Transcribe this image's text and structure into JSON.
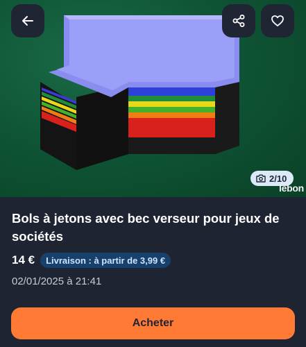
{
  "gallery": {
    "counter": "2/10",
    "watermark": "lebon"
  },
  "listing": {
    "title": "Bols à jetons avec bec verseur pour jeux de sociétés",
    "price": "14 €",
    "delivery_badge": "Livraison : à partir de 3,99 €",
    "date": "02/01/2025 à 21:41"
  },
  "actions": {
    "buy_label": "Acheter"
  },
  "icons": {
    "back": "arrow-left-icon",
    "share": "share-icon",
    "favorite": "heart-icon",
    "camera": "camera-icon"
  },
  "colors": {
    "background": "#1e2432",
    "buy_button": "#ff7a35",
    "delivery_badge": "#17416b"
  }
}
